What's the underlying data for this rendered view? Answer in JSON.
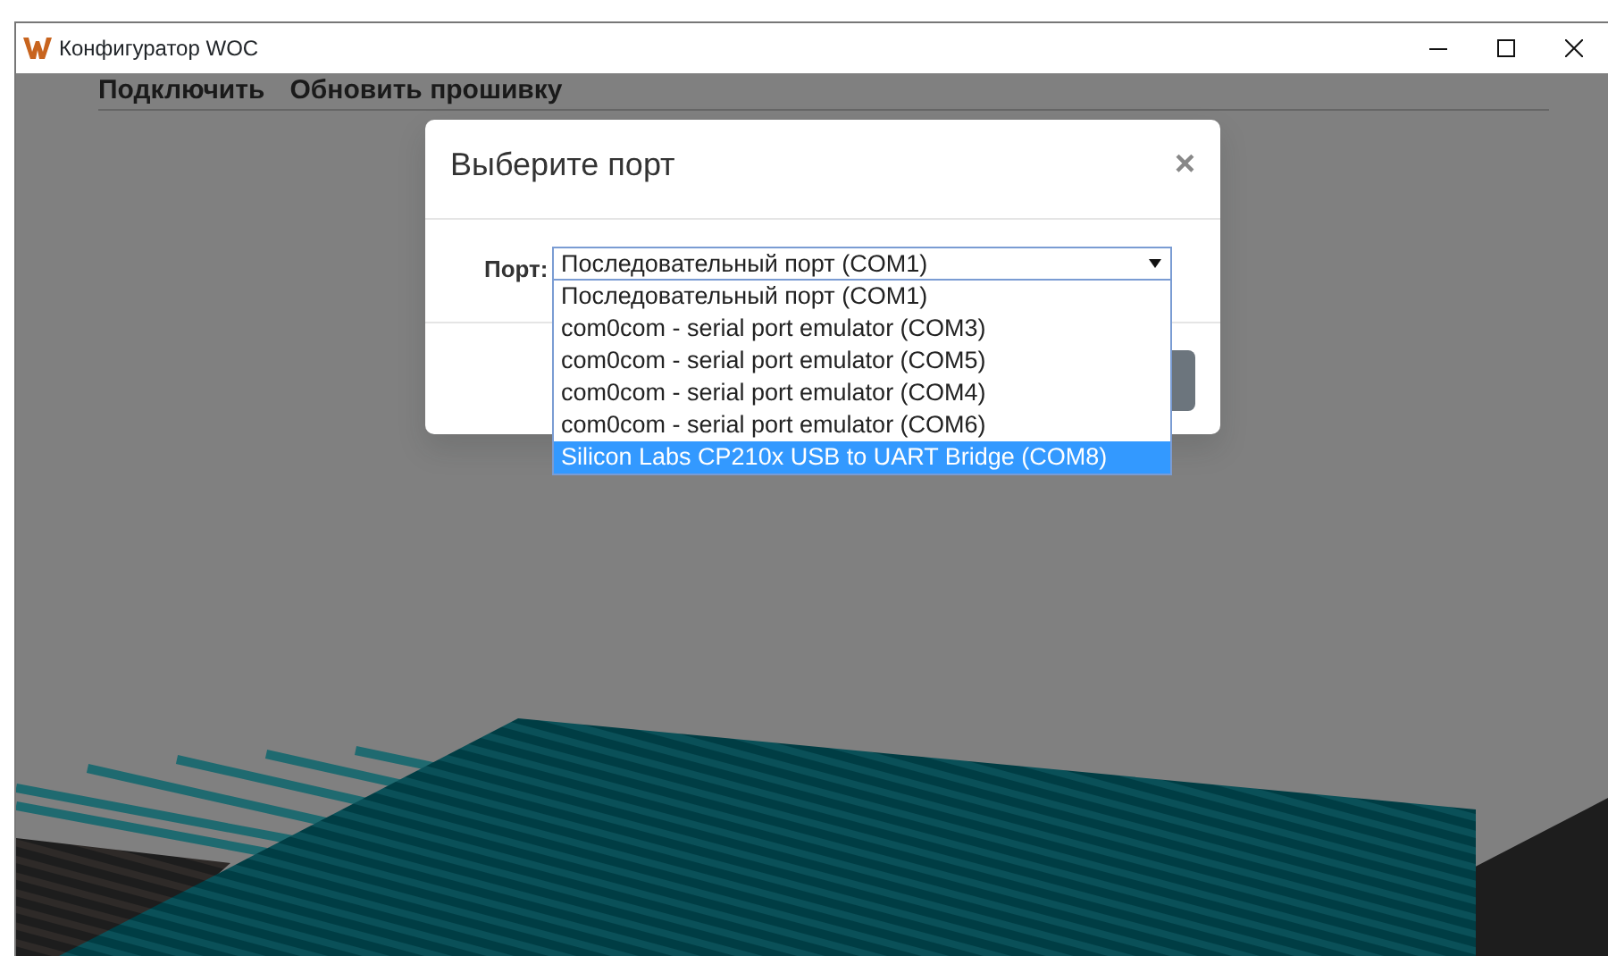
{
  "window": {
    "title": "Конфигуратор WOC"
  },
  "menu": [
    {
      "label": "Подключить"
    },
    {
      "label": "Обновить прошивку"
    }
  ],
  "dialog": {
    "title": "Выберите порт",
    "close": "×",
    "port_label": "Порт:",
    "port_value": "Последовательный порт (COM1)",
    "options": [
      {
        "label": "Последовательный порт (COM1)",
        "selected": false
      },
      {
        "label": "com0com - serial port emulator (COM3)",
        "selected": false
      },
      {
        "label": "com0com - serial port emulator (COM5)",
        "selected": false
      },
      {
        "label": "com0com - serial port emulator (COM4)",
        "selected": false
      },
      {
        "label": "com0com - serial port emulator (COM6)",
        "selected": false
      },
      {
        "label": "Silicon Labs CP210x USB to UART Bridge (COM8)",
        "selected": true
      }
    ]
  }
}
